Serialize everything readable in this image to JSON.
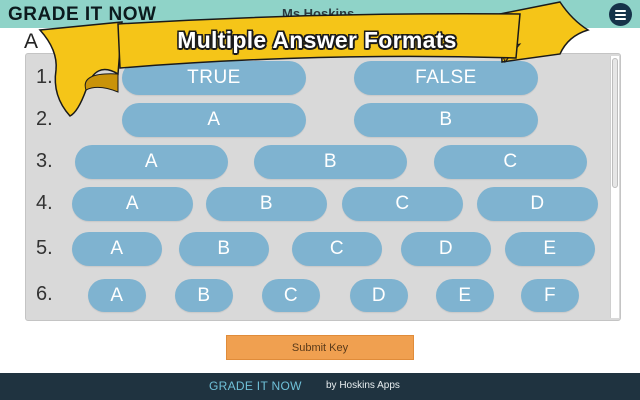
{
  "header": {
    "logo": "GRADE IT NOW",
    "teacher_name": "Ms Hoskins"
  },
  "banner": {
    "title": "Multiple Answer Formats",
    "ribbon_color": "#f5c518"
  },
  "partial_heading": "A",
  "rows": [
    {
      "number": "1.",
      "options": [
        "TRUE",
        "FALSE"
      ]
    },
    {
      "number": "2.",
      "options": [
        "A",
        "B"
      ]
    },
    {
      "number": "3.",
      "options": [
        "A",
        "B",
        "C"
      ]
    },
    {
      "number": "4.",
      "options": [
        "A",
        "B",
        "C",
        "D"
      ]
    },
    {
      "number": "5.",
      "options": [
        "A",
        "B",
        "C",
        "D",
        "E"
      ]
    },
    {
      "number": "6.",
      "options": [
        "A",
        "B",
        "C",
        "D",
        "E",
        "F"
      ]
    }
  ],
  "submit": {
    "label": "Submit Key"
  },
  "footer": {
    "brand": "GRADE IT NOW",
    "by": "by Hoskins Apps"
  },
  "colors": {
    "topbar": "#8fd3c8",
    "pill": "#7fb3d0",
    "submit": "#f0a050",
    "footer": "#1f3340"
  }
}
